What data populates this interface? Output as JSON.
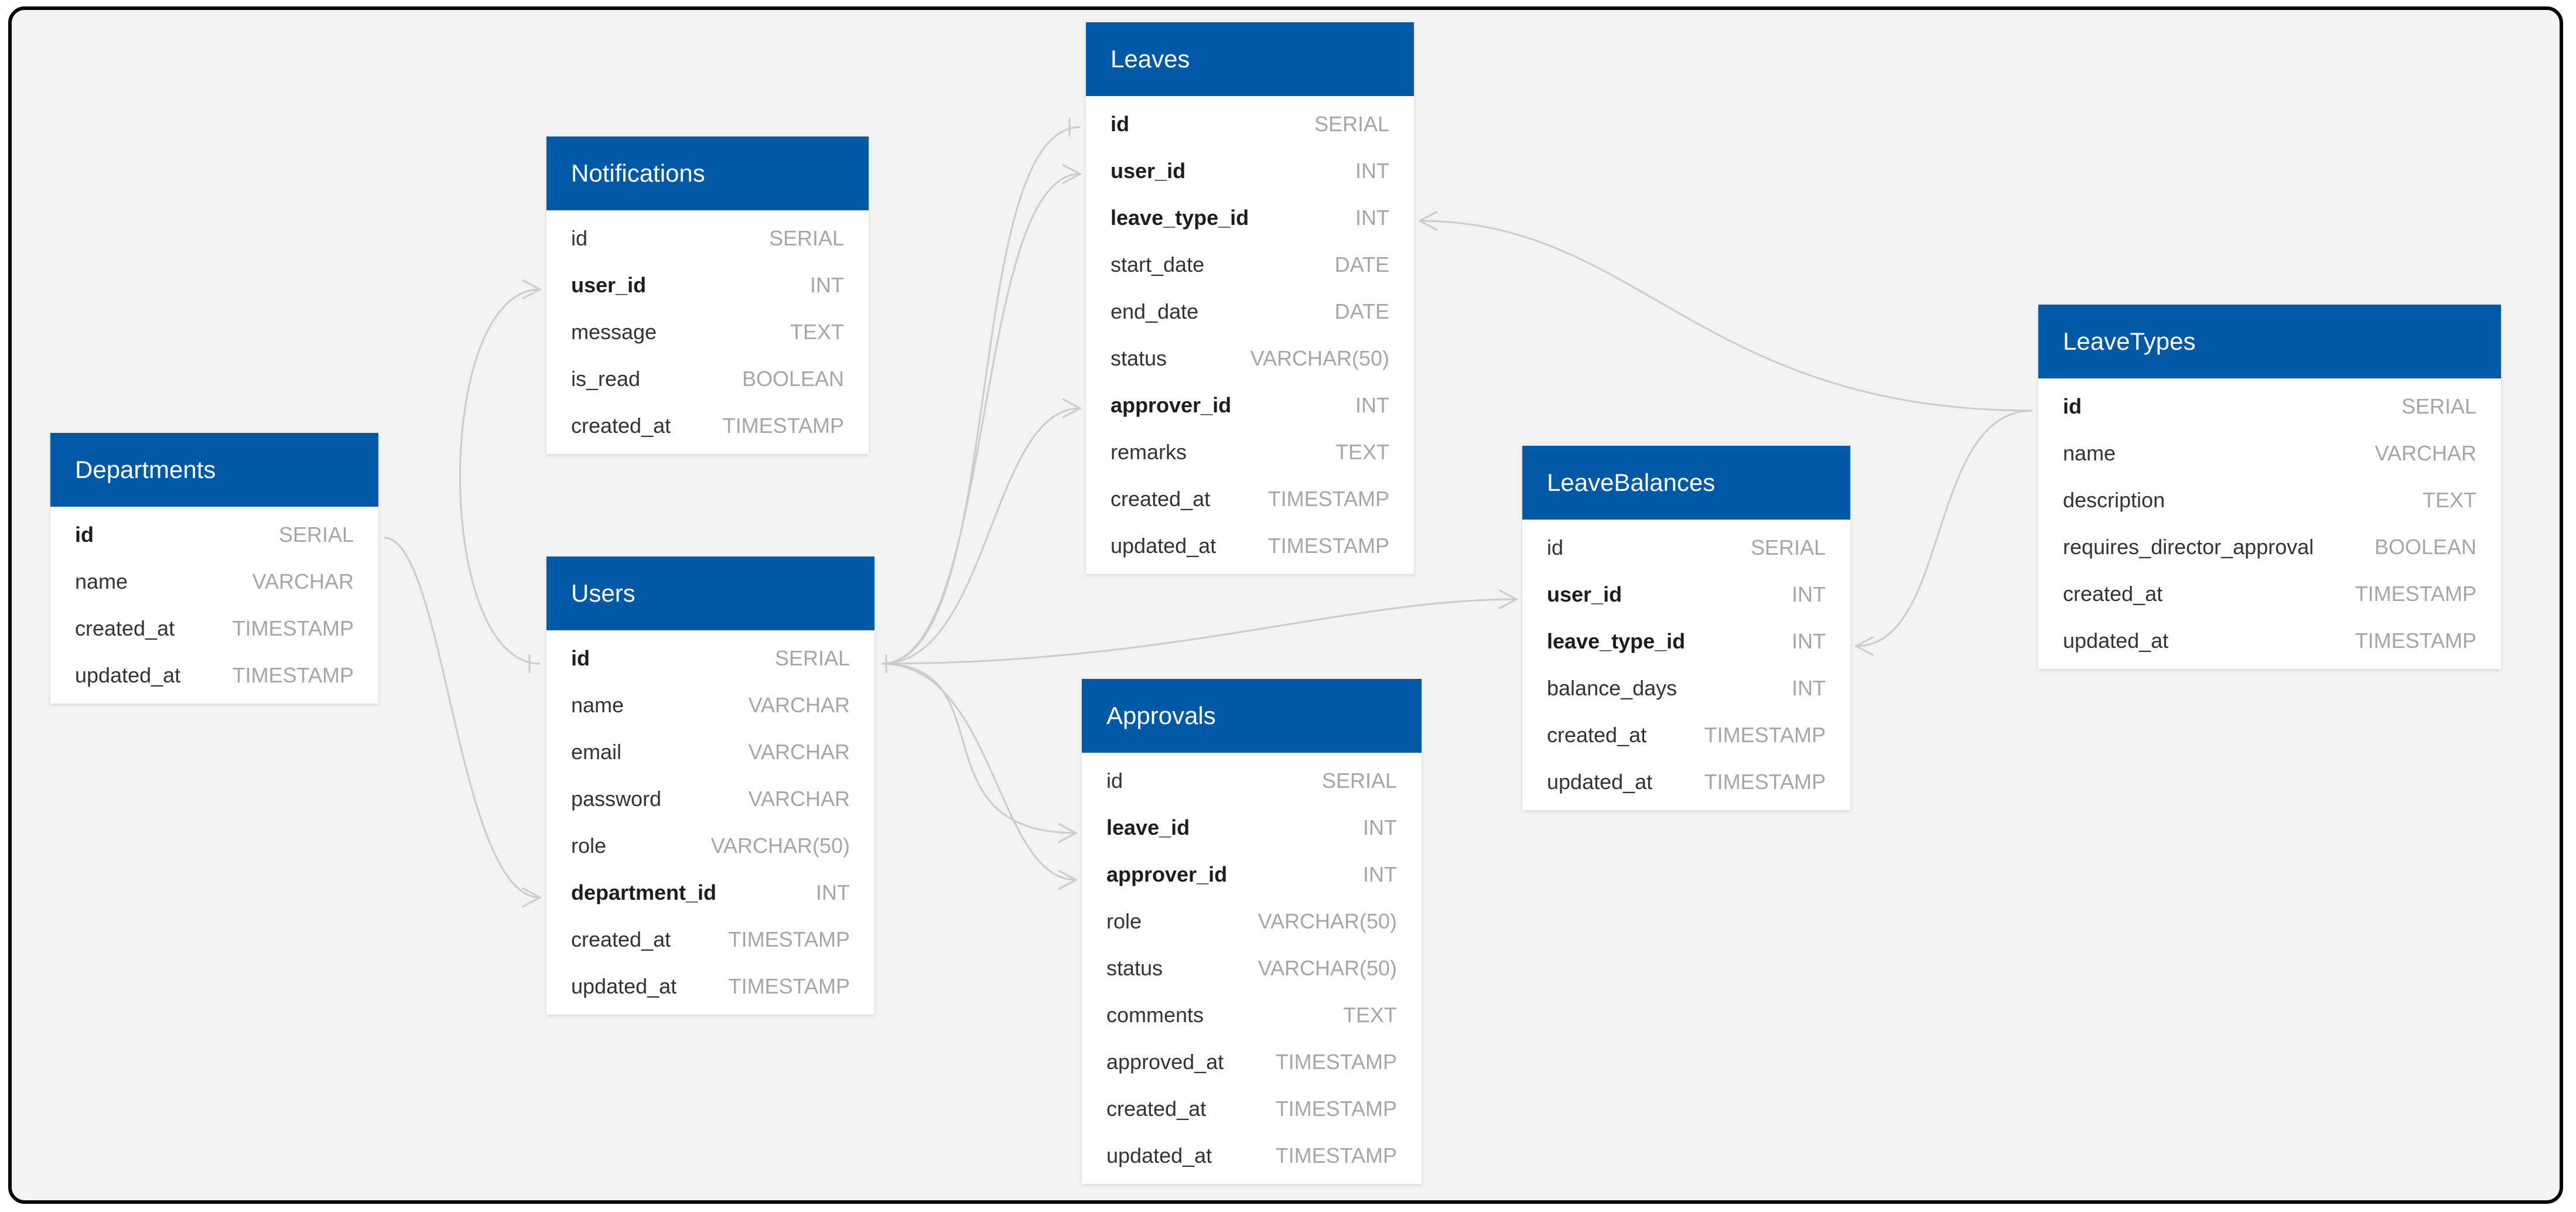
{
  "colors": {
    "header": "#0059a5",
    "connector": "#cccccc",
    "background": "#f3f3f3"
  },
  "tables": {
    "departments": {
      "title": "Departments",
      "columns": [
        {
          "name": "id",
          "type": "SERIAL",
          "key": true
        },
        {
          "name": "name",
          "type": "VARCHAR",
          "key": false
        },
        {
          "name": "created_at",
          "type": "TIMESTAMP",
          "key": false
        },
        {
          "name": "updated_at",
          "type": "TIMESTAMP",
          "key": false
        }
      ]
    },
    "notifications": {
      "title": "Notifications",
      "columns": [
        {
          "name": "id",
          "type": "SERIAL",
          "key": false
        },
        {
          "name": "user_id",
          "type": "INT",
          "key": true
        },
        {
          "name": "message",
          "type": "TEXT",
          "key": false
        },
        {
          "name": "is_read",
          "type": "BOOLEAN",
          "key": false
        },
        {
          "name": "created_at",
          "type": "TIMESTAMP",
          "key": false
        }
      ]
    },
    "users": {
      "title": "Users",
      "columns": [
        {
          "name": "id",
          "type": "SERIAL",
          "key": true
        },
        {
          "name": "name",
          "type": "VARCHAR",
          "key": false
        },
        {
          "name": "email",
          "type": "VARCHAR",
          "key": false
        },
        {
          "name": "password",
          "type": "VARCHAR",
          "key": false
        },
        {
          "name": "role",
          "type": "VARCHAR(50)",
          "key": false
        },
        {
          "name": "department_id",
          "type": "INT",
          "key": true
        },
        {
          "name": "created_at",
          "type": "TIMESTAMP",
          "key": false
        },
        {
          "name": "updated_at",
          "type": "TIMESTAMP",
          "key": false
        }
      ]
    },
    "leaves": {
      "title": "Leaves",
      "columns": [
        {
          "name": "id",
          "type": "SERIAL",
          "key": true
        },
        {
          "name": "user_id",
          "type": "INT",
          "key": true
        },
        {
          "name": "leave_type_id",
          "type": "INT",
          "key": true
        },
        {
          "name": "start_date",
          "type": "DATE",
          "key": false
        },
        {
          "name": "end_date",
          "type": "DATE",
          "key": false
        },
        {
          "name": "status",
          "type": "VARCHAR(50)",
          "key": false
        },
        {
          "name": "approver_id",
          "type": "INT",
          "key": true
        },
        {
          "name": "remarks",
          "type": "TEXT",
          "key": false
        },
        {
          "name": "created_at",
          "type": "TIMESTAMP",
          "key": false
        },
        {
          "name": "updated_at",
          "type": "TIMESTAMP",
          "key": false
        }
      ]
    },
    "approvals": {
      "title": "Approvals",
      "columns": [
        {
          "name": "id",
          "type": "SERIAL",
          "key": false
        },
        {
          "name": "leave_id",
          "type": "INT",
          "key": true
        },
        {
          "name": "approver_id",
          "type": "INT",
          "key": true
        },
        {
          "name": "role",
          "type": "VARCHAR(50)",
          "key": false
        },
        {
          "name": "status",
          "type": "VARCHAR(50)",
          "key": false
        },
        {
          "name": "comments",
          "type": "TEXT",
          "key": false
        },
        {
          "name": "approved_at",
          "type": "TIMESTAMP",
          "key": false
        },
        {
          "name": "created_at",
          "type": "TIMESTAMP",
          "key": false
        },
        {
          "name": "updated_at",
          "type": "TIMESTAMP",
          "key": false
        }
      ]
    },
    "leave_balances": {
      "title": "LeaveBalances",
      "columns": [
        {
          "name": "id",
          "type": "SERIAL",
          "key": false
        },
        {
          "name": "user_id",
          "type": "INT",
          "key": true
        },
        {
          "name": "leave_type_id",
          "type": "INT",
          "key": true
        },
        {
          "name": "balance_days",
          "type": "INT",
          "key": false
        },
        {
          "name": "created_at",
          "type": "TIMESTAMP",
          "key": false
        },
        {
          "name": "updated_at",
          "type": "TIMESTAMP",
          "key": false
        }
      ]
    },
    "leave_types": {
      "title": "LeaveTypes",
      "columns": [
        {
          "name": "id",
          "type": "SERIAL",
          "key": true
        },
        {
          "name": "name",
          "type": "VARCHAR",
          "key": false
        },
        {
          "name": "description",
          "type": "TEXT",
          "key": false
        },
        {
          "name": "requires_director_approval",
          "type": "BOOLEAN",
          "key": false
        },
        {
          "name": "created_at",
          "type": "TIMESTAMP",
          "key": false
        },
        {
          "name": "updated_at",
          "type": "TIMESTAMP",
          "key": false
        }
      ]
    }
  },
  "relationships": [
    {
      "from": "users.id",
      "to": "notifications.user_id"
    },
    {
      "from": "departments.id",
      "to": "users.department_id"
    },
    {
      "from": "users.id",
      "to": "leaves.id"
    },
    {
      "from": "users.id",
      "to": "leaves.user_id"
    },
    {
      "from": "users.id",
      "to": "leaves.approver_id"
    },
    {
      "from": "users.id",
      "to": "approvals.leave_id"
    },
    {
      "from": "users.id",
      "to": "approvals.approver_id"
    },
    {
      "from": "users.id",
      "to": "leave_balances.user_id"
    },
    {
      "from": "leave_types.id",
      "to": "leaves.leave_type_id"
    },
    {
      "from": "leave_types.id",
      "to": "leave_balances.leave_type_id"
    }
  ]
}
